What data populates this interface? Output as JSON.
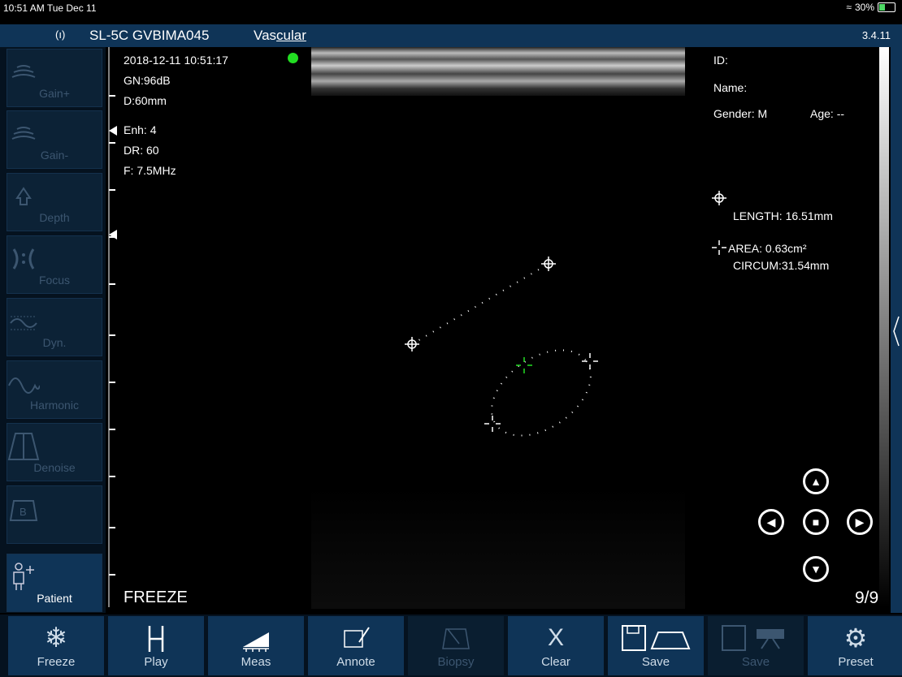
{
  "status": {
    "time": "10:51 AM  Tue Dec 11",
    "battery": "30%"
  },
  "header": {
    "probe": "SL-5C GVBIMA045",
    "mode_pre": "Vas",
    "mode_u": "cular",
    "version": "3.4.11"
  },
  "sidebar": [
    {
      "label": "Gain+",
      "icon": "gain-up-icon"
    },
    {
      "label": "Gain-",
      "icon": "gain-down-icon"
    },
    {
      "label": "Depth",
      "icon": "depth-icon"
    },
    {
      "label": "Focus",
      "icon": "focus-icon"
    },
    {
      "label": "Dyn.",
      "icon": "dynamic-icon"
    },
    {
      "label": "Harmonic",
      "icon": "harmonic-icon"
    },
    {
      "label": "Denoise",
      "icon": "denoise-icon"
    },
    {
      "label": "",
      "icon": "b-mode-icon"
    },
    {
      "label": "Patient",
      "icon": "patient-icon"
    }
  ],
  "params": {
    "datetime": "2018-12-11 10:51:17",
    "gain": "GN:96dB",
    "depth": "D:60mm",
    "enh": "Enh: 4",
    "dr": "DR: 60",
    "freq": "F: 7.5MHz"
  },
  "patient": {
    "id": "ID:",
    "name": "Name:",
    "gender": "Gender: M",
    "age": "Age: --"
  },
  "measurements": {
    "length": "LENGTH: 16.51mm",
    "area": "AREA: 0.63cm²",
    "circum": "CIRCUM:31.54mm"
  },
  "overlay": {
    "freeze": "FREEZE",
    "frames": "9/9"
  },
  "bottom": [
    {
      "label": "Freeze",
      "icon": "snowflake-icon",
      "enabled": true
    },
    {
      "label": "Play",
      "icon": "play-icon",
      "enabled": true
    },
    {
      "label": "Meas",
      "icon": "ruler-icon",
      "enabled": true
    },
    {
      "label": "Annote",
      "icon": "annotate-icon",
      "enabled": true
    },
    {
      "label": "Biopsy",
      "icon": "biopsy-icon",
      "enabled": false
    },
    {
      "label": "Clear",
      "icon": "clear-icon",
      "enabled": true
    },
    {
      "label": "Save",
      "icon": "save-image-icon",
      "enabled": true
    },
    {
      "label": "Save",
      "icon": "save-video-icon",
      "enabled": false
    },
    {
      "label": "Preset",
      "icon": "gear-icon",
      "enabled": true
    }
  ],
  "colors": {
    "header": "#0f3457",
    "accent_green": "#22dd22"
  }
}
